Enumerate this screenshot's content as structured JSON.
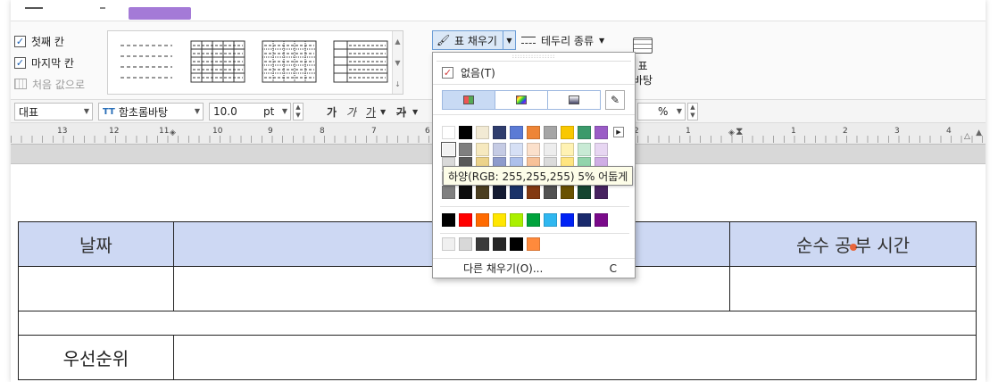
{
  "ribbon": {
    "checks": [
      {
        "label": "첫째 칸",
        "checked": true
      },
      {
        "label": "마지막 칸",
        "checked": true
      }
    ],
    "reset_label": "처음 값으로",
    "fill_button_label": "표 채우기",
    "border_type_label": "테두리 종류",
    "table_bg_label_1": "표",
    "table_bg_label_2": "바탕"
  },
  "format_bar": {
    "style": "대표",
    "font": "함초롬바탕",
    "font_icon": "TT",
    "size": "10.0",
    "unit": "pt",
    "bold": "가",
    "italic": "가",
    "underline": "가",
    "strike": "가",
    "percent": "%"
  },
  "ruler": {
    "numbers_left": [
      "13",
      "12",
      "11",
      "10",
      "9",
      "8",
      "7",
      "6"
    ],
    "numbers_right": [
      "2",
      "1",
      "1",
      "2",
      "3",
      "4"
    ]
  },
  "table": {
    "header_left": "날짜",
    "header_right_1": "순수 공",
    "header_right_2": "부 시간",
    "priority_label": "우선순위"
  },
  "fill_popup": {
    "grip": "::::::::::::::::",
    "none_label": "없음(T)",
    "none_checked": true,
    "other_fill_label": "다른 채우기(O)...",
    "other_fill_shortcut": "C",
    "theme_top": [
      "#ffffff",
      "#000000",
      "#f2ead4",
      "#2f3d6e",
      "#5b7bd5",
      "#ee8536",
      "#a5a5a5",
      "#f9c800",
      "#3b9a6b",
      "#9a5cc6"
    ],
    "theme_shades": [
      [
        "#f2f2f2",
        "#7f7f7f",
        "#f6e9bf",
        "#c5cbe4",
        "#d6e0f5",
        "#fbe0cb",
        "#ededed",
        "#fff2b3",
        "#c8ead5",
        "#e7d6f2"
      ],
      [
        "#d9d9d9",
        "#595959",
        "#ecd38a",
        "#8e9bcc",
        "#adc0eb",
        "#f7c198",
        "#dbdbdb",
        "#ffe580",
        "#92d4ab",
        "#cfaee5"
      ],
      [
        "#bfbfbf",
        "#3f3f3f",
        "#9a8044",
        "#1f2a4c",
        "#264b9e",
        "#c5561a",
        "#7b7b7b",
        "#9c7a00",
        "#1f6846",
        "#6b3590"
      ],
      [
        "#808080",
        "#0d0d0d",
        "#4b3e1f",
        "#141b32",
        "#1a3269",
        "#833911",
        "#525252",
        "#6a5200",
        "#154530",
        "#472360"
      ]
    ],
    "standard": [
      "#000000",
      "#ff0000",
      "#ff6a00",
      "#ffe600",
      "#aaf000",
      "#00a33c",
      "#2fb7f0",
      "#0022f5",
      "#1a2a6c",
      "#7a0a8a"
    ],
    "recent": [
      "#f0f0f0",
      "#d8d8d8",
      "#3a3a3a",
      "#262626",
      "#000000",
      "#ff8a3c"
    ],
    "tooltip": "하양(RGB: 255,255,255) 5% 어둡게"
  }
}
